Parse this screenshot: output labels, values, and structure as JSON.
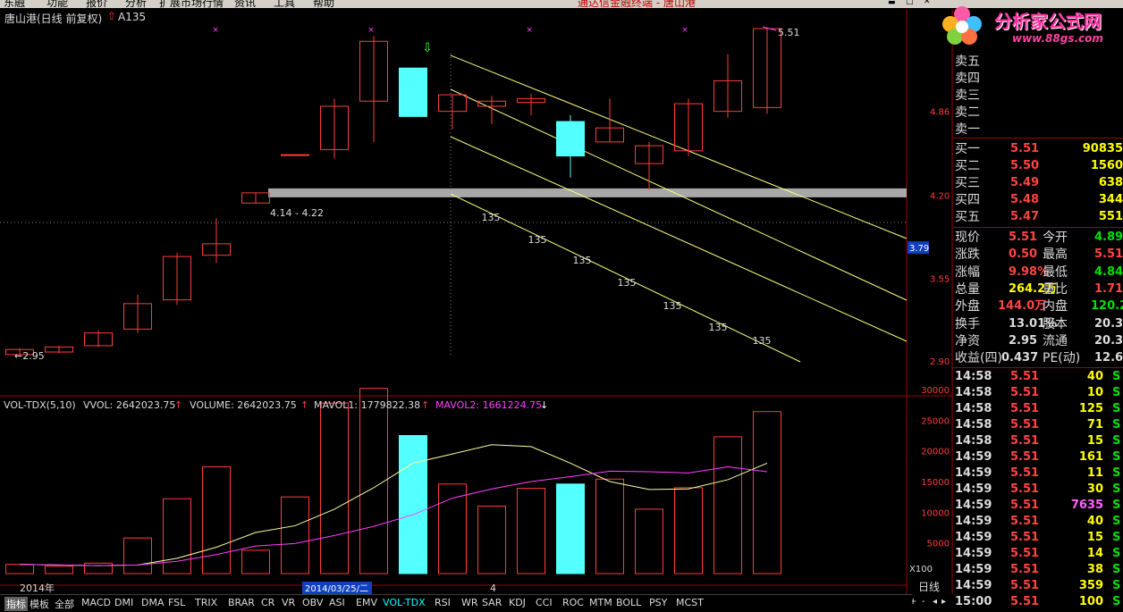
{
  "window": {
    "menu_items": [
      "东融",
      "功能",
      "报价",
      "分析",
      "扩展市场行情",
      "资讯",
      "工具",
      "帮助"
    ],
    "title_center": "通达信金融终端 - 唐山港"
  },
  "logo": {
    "text": "分析家公式网",
    "url": "www.88gs.com"
  },
  "chart_header": {
    "stock": "唐山港(日线 前复权)",
    "formula": "A135"
  },
  "price_axis": {
    "labels": [
      "5.51",
      "4.86",
      "4.20",
      "3.79",
      "3.55",
      "2.90"
    ]
  },
  "annotations": {
    "high_label": "5.51",
    "zone_label": "4.14 - 4.22",
    "low_label": "←2.95",
    "fan_labels": [
      "135",
      "135",
      "135",
      "135",
      "135",
      "135",
      "135"
    ]
  },
  "volume_header": {
    "name": "VOL-TDX(5,10)",
    "vvol": "VVOL: 2642023.75",
    "volume": "VOLUME: 2642023.75",
    "mavol1": "MAVOL1: 1779822.38",
    "mavol2": "MAVOL2: 1661224.75"
  },
  "volume_axis": {
    "labels": [
      "30000",
      "25000",
      "20000",
      "15000",
      "10000",
      "5000"
    ],
    "unit": "X100"
  },
  "date_axis": {
    "start": "2014年",
    "cursor": "2014/03/25/二",
    "month": "4"
  },
  "period_label": "日线",
  "order_book": {
    "sell": [
      {
        "label": "卖五",
        "price": "",
        "vol": ""
      },
      {
        "label": "卖四",
        "price": "",
        "vol": ""
      },
      {
        "label": "卖三",
        "price": "",
        "vol": ""
      },
      {
        "label": "卖二",
        "price": "",
        "vol": ""
      },
      {
        "label": "卖一",
        "price": "",
        "vol": ""
      }
    ],
    "buy": [
      {
        "label": "买一",
        "price": "5.51",
        "vol": "90835"
      },
      {
        "label": "买二",
        "price": "5.50",
        "vol": "1560"
      },
      {
        "label": "买三",
        "price": "5.49",
        "vol": "638"
      },
      {
        "label": "买四",
        "price": "5.48",
        "vol": "344"
      },
      {
        "label": "买五",
        "price": "5.47",
        "vol": "551"
      }
    ]
  },
  "quote": [
    {
      "l1": "现价",
      "v1": "5.51",
      "l2": "今开",
      "v2": "4.89"
    },
    {
      "l1": "涨跌",
      "v1": "0.50",
      "l2": "最高",
      "v2": "5.51"
    },
    {
      "l1": "涨幅",
      "v1": "9.98%",
      "l2": "最低",
      "v2": "4.84"
    },
    {
      "l1": "总量",
      "v1": "264.2万",
      "l2": "量比",
      "v2": "1.71"
    },
    {
      "l1": "外盘",
      "v1": "144.0万",
      "l2": "内盘",
      "v2": "120.2万"
    },
    {
      "l1": "换手",
      "v1": "13.01%",
      "l2": "股本",
      "v2": "20.3亿"
    },
    {
      "l1": "净资",
      "v1": "2.95",
      "l2": "流通",
      "v2": "20.3亿"
    },
    {
      "l1": "收益(四)",
      "v1": "0.437",
      "l2": "PE(动)",
      "v2": "12.6"
    }
  ],
  "ticks": [
    {
      "time": "14:58",
      "price": "5.51",
      "vol": "40",
      "bs": "S"
    },
    {
      "time": "14:58",
      "price": "5.51",
      "vol": "10",
      "bs": "S"
    },
    {
      "time": "14:58",
      "price": "5.51",
      "vol": "125",
      "bs": "S"
    },
    {
      "time": "14:58",
      "price": "5.51",
      "vol": "71",
      "bs": "S"
    },
    {
      "time": "14:58",
      "price": "5.51",
      "vol": "15",
      "bs": "S"
    },
    {
      "time": "14:59",
      "price": "5.51",
      "vol": "161",
      "bs": "S"
    },
    {
      "time": "14:59",
      "price": "5.51",
      "vol": "11",
      "bs": "S"
    },
    {
      "time": "14:59",
      "price": "5.51",
      "vol": "30",
      "bs": "S"
    },
    {
      "time": "14:59",
      "price": "5.51",
      "vol": "7635",
      "bs": "S"
    },
    {
      "time": "14:59",
      "price": "5.51",
      "vol": "40",
      "bs": "S"
    },
    {
      "time": "14:59",
      "price": "5.51",
      "vol": "15",
      "bs": "S"
    },
    {
      "time": "14:59",
      "price": "5.51",
      "vol": "14",
      "bs": "S"
    },
    {
      "time": "14:59",
      "price": "5.51",
      "vol": "38",
      "bs": "S"
    },
    {
      "time": "14:59",
      "price": "5.51",
      "vol": "359",
      "bs": "S"
    },
    {
      "time": "15:00",
      "price": "5.51",
      "vol": "100",
      "bs": "S"
    }
  ],
  "bottom_tabs": [
    "指标",
    "模板",
    "全部",
    "MACD",
    "DMI",
    "DMA",
    "FSL",
    "TRIX",
    "BRAR",
    "CR",
    "VR",
    "OBV",
    "ASI",
    "EMV",
    "VOL-TDX",
    "RSI",
    "WR",
    "SAR",
    "KDJ",
    "CCI",
    "ROC",
    "MTM",
    "BOLL",
    "PSY",
    "MCST"
  ],
  "active_tab": "VOL-TDX",
  "colors": {
    "up": "#ff3c3c",
    "down": "#54ffff",
    "ma1": "#ffffa0",
    "ma2": "#ff40ff",
    "fan": "#ffff80"
  },
  "chart_data": {
    "type": "candlestick",
    "candles": [
      {
        "open": 2.95,
        "close": 2.99,
        "high": 3.0,
        "low": 2.93,
        "vol": 1500
      },
      {
        "open": 2.97,
        "close": 3.01,
        "high": 3.02,
        "low": 2.96,
        "vol": 1200
      },
      {
        "open": 3.02,
        "close": 3.12,
        "high": 3.14,
        "low": 3.01,
        "vol": 1700
      },
      {
        "open": 3.15,
        "close": 3.35,
        "high": 3.42,
        "low": 3.12,
        "vol": 5800
      },
      {
        "open": 3.38,
        "close": 3.72,
        "high": 3.75,
        "low": 3.34,
        "vol": 12200
      },
      {
        "open": 3.73,
        "close": 3.82,
        "high": 4.02,
        "low": 3.67,
        "vol": 17400
      },
      {
        "open": 4.14,
        "close": 4.22,
        "high": 4.22,
        "low": 4.14,
        "vol": 3800
      },
      {
        "open": 4.52,
        "close": 4.52,
        "high": 4.52,
        "low": 4.52,
        "vol": 12500
      },
      {
        "open": 4.56,
        "close": 4.9,
        "high": 4.96,
        "low": 4.49,
        "vol": 27800
      },
      {
        "open": 4.94,
        "close": 5.41,
        "high": 5.45,
        "low": 4.62,
        "vol": 30200
      },
      {
        "open": 5.2,
        "close": 4.82,
        "high": 5.2,
        "low": 4.82,
        "vol": 22500
      },
      {
        "open": 4.86,
        "close": 4.99,
        "high": 4.99,
        "low": 4.72,
        "vol": 14600
      },
      {
        "open": 4.9,
        "close": 4.94,
        "high": 4.98,
        "low": 4.76,
        "vol": 11000
      },
      {
        "open": 4.93,
        "close": 4.96,
        "high": 5.0,
        "low": 4.83,
        "vol": 13900
      },
      {
        "open": 4.78,
        "close": 4.51,
        "high": 4.83,
        "low": 4.34,
        "vol": 14600
      },
      {
        "open": 4.62,
        "close": 4.73,
        "high": 4.96,
        "low": 4.62,
        "vol": 15400
      },
      {
        "open": 4.45,
        "close": 4.59,
        "high": 4.62,
        "low": 4.24,
        "vol": 10500
      },
      {
        "open": 4.55,
        "close": 4.92,
        "high": 4.96,
        "low": 4.51,
        "vol": 14000
      },
      {
        "open": 4.86,
        "close": 5.1,
        "high": 5.31,
        "low": 4.81,
        "vol": 22300
      },
      {
        "open": 4.89,
        "close": 5.51,
        "high": 5.51,
        "low": 4.84,
        "vol": 26400
      }
    ],
    "mavol1": [
      1500,
      1400,
      1300,
      1400,
      2500,
      4300,
      6700,
      7800,
      10500,
      14000,
      18000,
      19500,
      21000,
      20700,
      18000,
      15000,
      13700,
      13800,
      15300,
      18000
    ],
    "mavol2": [
      1500,
      1400,
      1300,
      1400,
      2000,
      3100,
      4500,
      4900,
      6200,
      7700,
      9600,
      12300,
      13800,
      15000,
      15800,
      16700,
      16600,
      16400,
      17400,
      16600
    ],
    "price_range": [
      2.9,
      5.51
    ],
    "volume_range": [
      0,
      30000
    ]
  }
}
